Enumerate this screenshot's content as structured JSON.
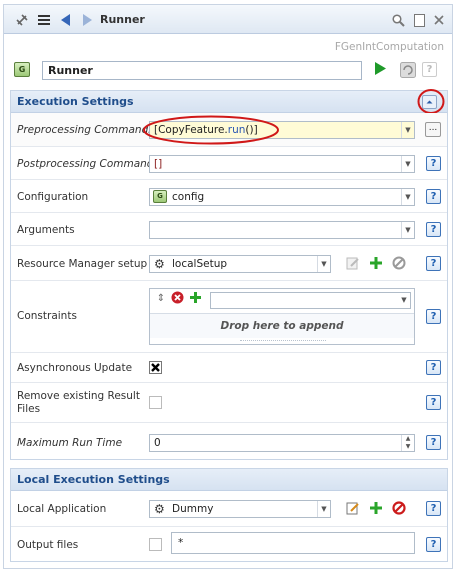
{
  "titlebar": {
    "title": "Runner",
    "icons": [
      "connect-icon",
      "list-icon",
      "back-icon",
      "forward-icon",
      "search-icon",
      "window-icon",
      "close-icon"
    ]
  },
  "class_name": "FGenIntComputation",
  "component": {
    "name": "Runner",
    "icon_letter": "G"
  },
  "execution_settings": {
    "title": "Execution Settings",
    "preprocessing": {
      "label": "Preprocessing Commands",
      "value_prefix": "[CopyFeature.",
      "value_method": "run",
      "value_suffix": "()]",
      "more": "..."
    },
    "postprocessing": {
      "label": "Postprocessing Commands",
      "value": "[]"
    },
    "configuration": {
      "label": "Configuration",
      "value": "config"
    },
    "arguments": {
      "label": "Arguments",
      "value": ""
    },
    "resource_manager": {
      "label": "Resource Manager setup",
      "value": "localSetup"
    },
    "constraints": {
      "label": "Constraints",
      "drop_text": "Drop here to append"
    },
    "async": {
      "label": "Asynchronous Update",
      "checked": true
    },
    "remove_results": {
      "label_1": "Remove existing Result",
      "label_2": "Files",
      "checked": false
    },
    "max_run_time": {
      "label": "Maximum Run Time",
      "value": "0"
    }
  },
  "local_execution_settings": {
    "title": "Local Execution Settings",
    "local_application": {
      "label": "Local Application",
      "value": "Dummy"
    },
    "output_files": {
      "label": "Output files",
      "value": "*",
      "checked": false
    }
  },
  "help_label": "?",
  "colors": {
    "accent": "#1f4d8b",
    "annotation": "#d01818",
    "highlight": "#fffbd6"
  }
}
